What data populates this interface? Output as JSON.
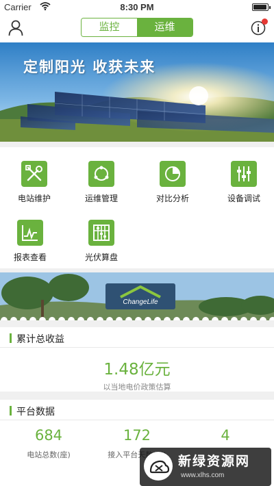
{
  "status_bar": {
    "carrier": "Carrier",
    "time": "8:30 PM"
  },
  "nav": {
    "tabs": [
      {
        "label": "监控",
        "active": false
      },
      {
        "label": "运维",
        "active": true
      }
    ]
  },
  "banner": {
    "slogan": "定制阳光 收获未来"
  },
  "grid": {
    "items": [
      {
        "label": "电站维护",
        "icon": "tools-icon"
      },
      {
        "label": "运维管理",
        "icon": "cycle-icon"
      },
      {
        "label": "对比分析",
        "icon": "pie-chart-icon"
      },
      {
        "label": "设备调试",
        "icon": "sliders-icon"
      },
      {
        "label": "报表查看",
        "icon": "line-chart-icon"
      },
      {
        "label": "光伏算盘",
        "icon": "abacus-icon"
      }
    ]
  },
  "promo": {
    "logo_text": "ChangeLife"
  },
  "earnings": {
    "title": "累计总收益",
    "value": "1.48亿元",
    "note": "以当地电价政策估算"
  },
  "platform": {
    "title": "平台数据",
    "stats": [
      {
        "value": "684",
        "label": "电站总数(座)"
      },
      {
        "value": "172",
        "label": "接入平台天数(天)"
      },
      {
        "value": "4",
        "label": ""
      }
    ]
  },
  "watermark": {
    "title": "新绿资源网",
    "url": "www.xlhs.com"
  },
  "colors": {
    "accent": "#6ab23e",
    "badge": "#e53935"
  }
}
